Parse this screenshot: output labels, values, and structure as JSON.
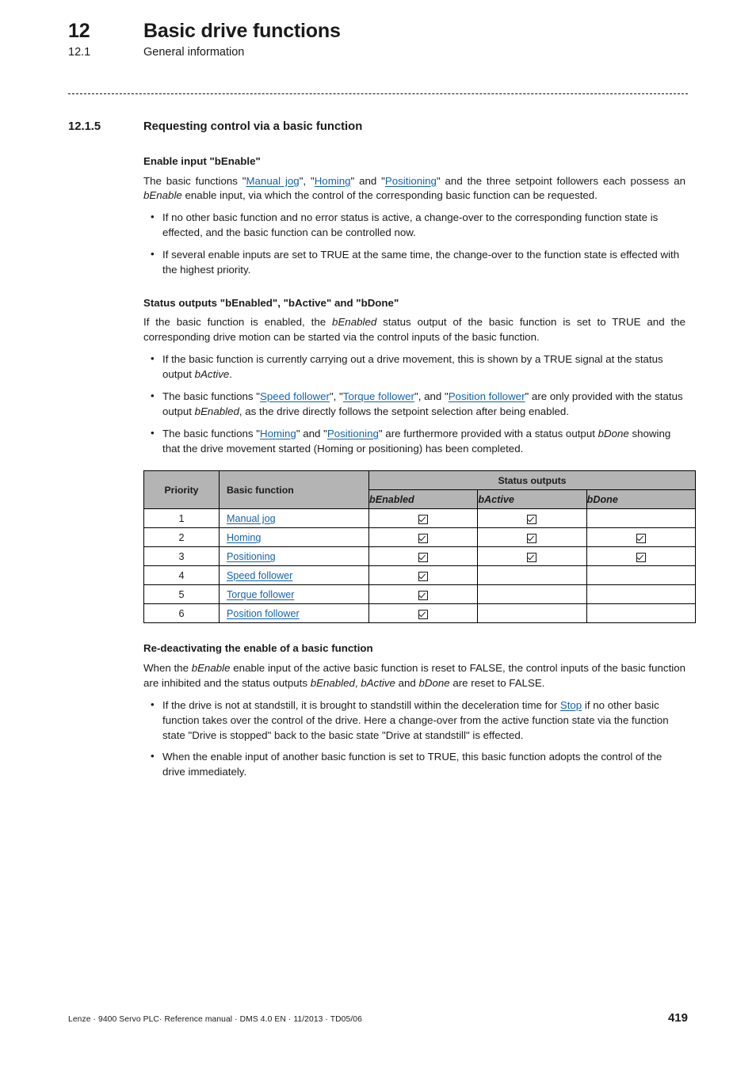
{
  "header": {
    "chapter_number": "12",
    "chapter_title": "Basic drive functions",
    "section_number": "12.1",
    "section_title": "General information"
  },
  "section": {
    "number": "12.1.5",
    "title": "Requesting control via a basic function"
  },
  "blocks": {
    "enable_heading": "Enable input \"bEnable\"",
    "enable_para_1": "The basic functions \"",
    "enable_para_link1": "Manual jog",
    "enable_para_2": "\", \"",
    "enable_para_link2": "Homing",
    "enable_para_3": "\" and \"",
    "enable_para_link3": "Positioning",
    "enable_para_4": "\" and the three setpoint followers each possess an ",
    "enable_para_em": "bEnable",
    "enable_para_5": " enable input, via which the control of the corresponding basic function can be requested.",
    "enable_bullet_1": "If no other basic function and no error status is active, a change-over to the corresponding function state is effected, and the basic function can be controlled now.",
    "enable_bullet_2": "If several enable inputs are set to TRUE at the same time, the change-over to the function state is effected with the highest priority.",
    "status_heading": "Status outputs \"bEnabled\", \"bActive\" and \"bDone\"",
    "status_para_1": "If the basic function is enabled, the ",
    "status_para_em": "bEnabled",
    "status_para_2": " status output of the basic function is set to TRUE and the corresponding drive motion can be started via the control inputs of the basic function.",
    "status_b1_1": "If the basic function is currently carrying out a drive movement, this is shown by a TRUE signal at the status output ",
    "status_b1_em": "bActive",
    "status_b1_2": ".",
    "status_b2_1": "The basic functions \"",
    "status_b2_link1": "Speed follower",
    "status_b2_2": "\", \"",
    "status_b2_link2": "Torque follower",
    "status_b2_3": "\", and \"",
    "status_b2_link3": "Position follower",
    "status_b2_4": "\" are only provided with the status output ",
    "status_b2_em": "bEnabled",
    "status_b2_5": ", as the drive directly follows the setpoint selection after being enabled.",
    "status_b3_1": "The basic functions \"",
    "status_b3_link1": "Homing",
    "status_b3_2": "\" and \"",
    "status_b3_link2": "Positioning",
    "status_b3_3": "\" are furthermore provided with a status output ",
    "status_b3_em": "bDone",
    "status_b3_4": " showing that the drive movement started (Homing or positioning) has been completed.",
    "redeact_heading": "Re-deactivating the enable of a basic function",
    "redeact_para_1": "When the ",
    "redeact_para_em1": "bEnable",
    "redeact_para_2": " enable input of the active basic function is reset to FALSE, the control inputs of the basic function are inhibited and the status outputs ",
    "redeact_para_em2": "bEnabled",
    "redeact_para_3": ", ",
    "redeact_para_em3": "bActive",
    "redeact_para_4": " and ",
    "redeact_para_em4": "bDone",
    "redeact_para_5": " are reset to FALSE.",
    "redeact_b1_1": "If the drive is not at standstill, it is brought to standstill within the deceleration time for ",
    "redeact_b1_link": "Stop",
    "redeact_b1_2": " if no other basic function takes over the control of the drive. Here a change-over from the active function state via the function state \"Drive is stopped\" back to the basic state \"Drive at standstill\" is effected.",
    "redeact_b2": "When the enable input of another basic function is set to TRUE, this basic function adopts the control of the drive immediately."
  },
  "table": {
    "headers": {
      "priority": "Priority",
      "basic_function": "Basic function",
      "status_outputs": "Status outputs",
      "b_enabled": "bEnabled",
      "b_active": "bActive",
      "b_done": "bDone"
    },
    "rows": [
      {
        "priority": "1",
        "function": "Manual jog",
        "bEnabled": true,
        "bActive": true,
        "bDone": false
      },
      {
        "priority": "2",
        "function": "Homing",
        "bEnabled": true,
        "bActive": true,
        "bDone": true
      },
      {
        "priority": "3",
        "function": "Positioning",
        "bEnabled": true,
        "bActive": true,
        "bDone": true
      },
      {
        "priority": "4",
        "function": "Speed follower",
        "bEnabled": true,
        "bActive": false,
        "bDone": false
      },
      {
        "priority": "5",
        "function": "Torque follower",
        "bEnabled": true,
        "bActive": false,
        "bDone": false
      },
      {
        "priority": "6",
        "function": "Position follower",
        "bEnabled": true,
        "bActive": false,
        "bDone": false
      }
    ]
  },
  "footer": {
    "text": "Lenze · 9400 Servo PLC· Reference manual · DMS 4.0 EN · 11/2013 · TD05/06",
    "page_number": "419"
  },
  "colors": {
    "link": "#1462ac",
    "table_header_bg": "#b4b4b4",
    "text": "#1a1a1a"
  }
}
